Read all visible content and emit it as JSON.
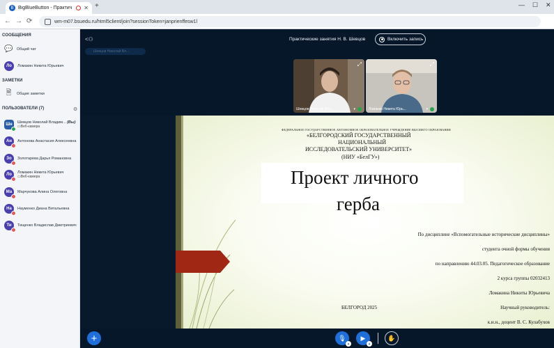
{
  "browser": {
    "tab_title": "BigBlueButton - Практич",
    "tab_favicon": "B",
    "url": "wm-m07.bsuedu.ru/html5client/join?sessionToken=janprienffesw1l"
  },
  "sidebar": {
    "messages_header": "СООБЩЕНИЯ",
    "public_chat": "Общий чат",
    "private_chat": {
      "initials": "Ло",
      "name": "Ломакин Никита Юрьевич"
    },
    "notes_header": "ЗАМЕТКИ",
    "shared_notes": "Общие заметки",
    "users_header": "ПОЛЬЗОВАТЕЛИ (7)",
    "users": [
      {
        "initials": "Ше",
        "name": "Шевцов Николай Владим...",
        "you": "(Вы)",
        "sub": "Веб-камера"
      },
      {
        "initials": "Ан",
        "name": "Антонова Анастасия Алексеевна",
        "sub": ""
      },
      {
        "initials": "Зо",
        "name": "Золотарева Дарья Романовна",
        "sub": ""
      },
      {
        "initials": "Ло",
        "name": "Ломакин Никита Юрьевич",
        "sub": "Веб-камера"
      },
      {
        "initials": "Ма",
        "name": "Марчукова Алина Олеговна",
        "sub": ""
      },
      {
        "initials": "На",
        "name": "Науменко Диана Витальевна",
        "sub": ""
      },
      {
        "initials": "Ти",
        "name": "Тищенко Владислав Дмитриевич",
        "sub": ""
      }
    ]
  },
  "header": {
    "meeting_title": "Практические занятия Н. В. Шевцов",
    "record_label": "Включить запись",
    "talking_indicator": "Шевцов Николай Вл..."
  },
  "videos": [
    {
      "name": "Шевцов Николай Вла..."
    },
    {
      "name": "Ломакин Никита Юрь..."
    }
  ],
  "slide": {
    "org_small": "ФЕДЕРАЛЬНОЕ ГОСУДАРСТВЕННОЕ АВТОНОМНОЕ ОБРАЗОВАТЕЛЬНОЕ УЧРЕЖДЕНИЕ ВЫСШЕГО ОБРАЗОВАНИЯ",
    "org_line1": "«БЕЛГОРОДСКИЙ ГОСУДАРСТВЕННЫЙ",
    "org_line2": "НАЦИОНАЛЬНЫЙ",
    "org_line3": "ИССЛЕДОВАТЕЛЬСКИЙ УНИВЕРСИТЕТ»",
    "org_line4": "(НИУ «БелГУ»)",
    "title_line1": "Проект личного",
    "title_line2": "герба",
    "r1": "По дисциплине «Вспомогательные исторические дисциплины»",
    "r2": "студента очной формы обучения",
    "r3": "по направлению 44.03.05. Педагогическое образование",
    "r4": "2 курса группы 02032413",
    "r5": "Ломакина Никиты Юрьевича",
    "r6": "Научный руководитель:",
    "r7": "к.и.н., доцент В. С. Кулабухов",
    "city": "БЕЛГОРОД 2025"
  },
  "colors": {
    "accent": "#1e6fd9",
    "dark_bg": "#06172a",
    "arrow": "#a02714"
  }
}
